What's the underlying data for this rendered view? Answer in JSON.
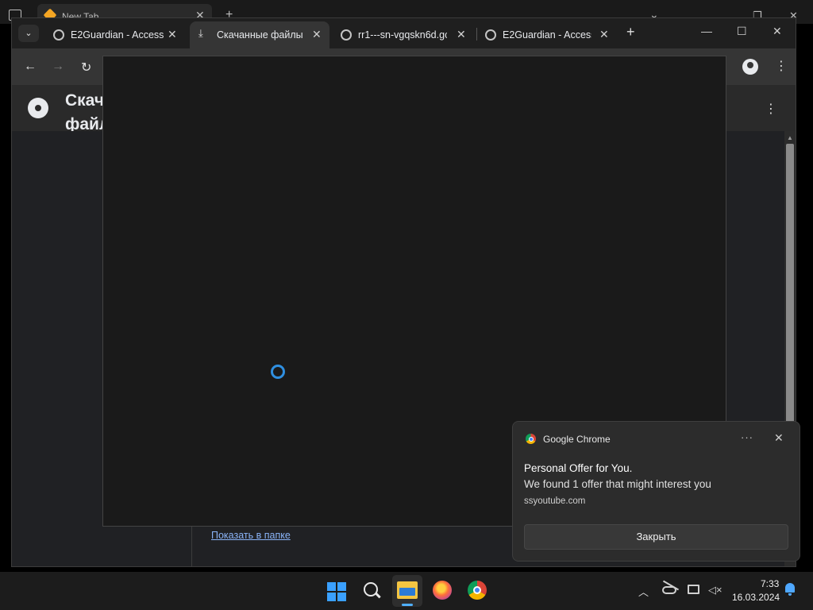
{
  "background_window": {
    "tab_label": "New Tab"
  },
  "tabs": [
    {
      "label": "E2Guardian - Access",
      "icon": "globe-icon",
      "active": false
    },
    {
      "label": "Скачанные файлы",
      "icon": "download-icon",
      "active": true
    },
    {
      "label": "rr1---sn-vgqskn6d.gc",
      "icon": "globe-icon",
      "active": false
    },
    {
      "label": "E2Guardian - Access",
      "icon": "globe-icon",
      "active": false
    }
  ],
  "page": {
    "title": "Скачанные файлы",
    "show_in_folder_link": "Показать в папке"
  },
  "toast": {
    "app_name": "Google Chrome",
    "title": "Personal Offer for You.",
    "body": "We found 1 offer that might interest you",
    "source": "ssyoutube.com",
    "button_label": "Закрыть",
    "more_label": "···"
  },
  "taskbar": {
    "time": "7:33",
    "date": "16.03.2024",
    "apps": [
      "windows-start-icon",
      "search-icon",
      "file-explorer-icon",
      "firefox-icon",
      "chrome-icon"
    ]
  },
  "colors": {
    "accent": "#3aa0ff",
    "link": "#8ab4f8",
    "spinner": "#2f8fe0"
  }
}
